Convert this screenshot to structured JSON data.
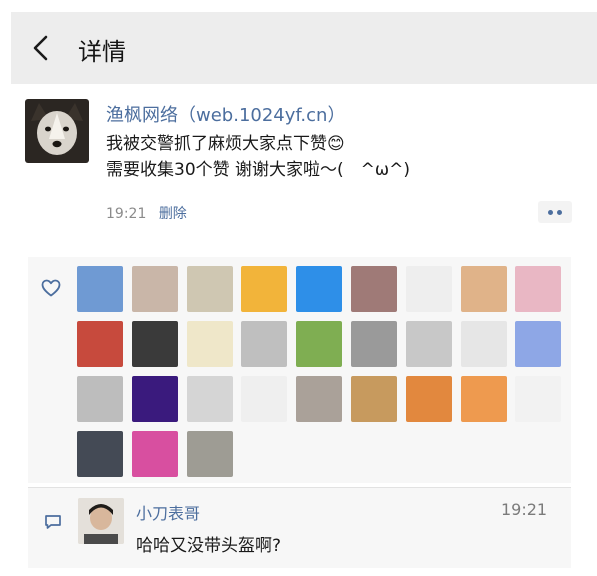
{
  "nav": {
    "title": "详情",
    "back_icon": "chevron-left-icon"
  },
  "post": {
    "author": "渔枫网络（web.1024yf.cn）",
    "line1": "我被交警抓了麻烦大家点下赞😊",
    "line2": "需要收集30个赞 谢谢大家啦～(　^ω^)",
    "time": "19:21",
    "delete_label": "删除"
  },
  "likes": {
    "icon": "heart-icon",
    "avatar_colors": [
      "#6f9ad3",
      "#c9b6a8",
      "#cfc7b2",
      "#f2b43a",
      "#2e8fe8",
      "#9f7a77",
      "#eeeeee",
      "#e0b389",
      "#e9b7c4",
      "#c74a3d",
      "#3a3a3a",
      "#efe7c9",
      "#bfbfbf",
      "#7fae52",
      "#9a9a9a",
      "#c8c8c8",
      "#e6e6e6",
      "#8ea7e6",
      "#bdbdbd",
      "#3a1a7d",
      "#d5d5d5",
      "#efefef",
      "#aaa199",
      "#c79a5e",
      "#e2883e",
      "#ee9a4f",
      "#f2f2f2",
      "#444a55",
      "#d84fa0",
      "#9e9c94"
    ]
  },
  "comment": {
    "icon": "comment-icon",
    "avatar_color": "#e7e4df",
    "name": "小刀表哥",
    "time": "19:21",
    "text": "哈哈又没带头盔啊?"
  }
}
